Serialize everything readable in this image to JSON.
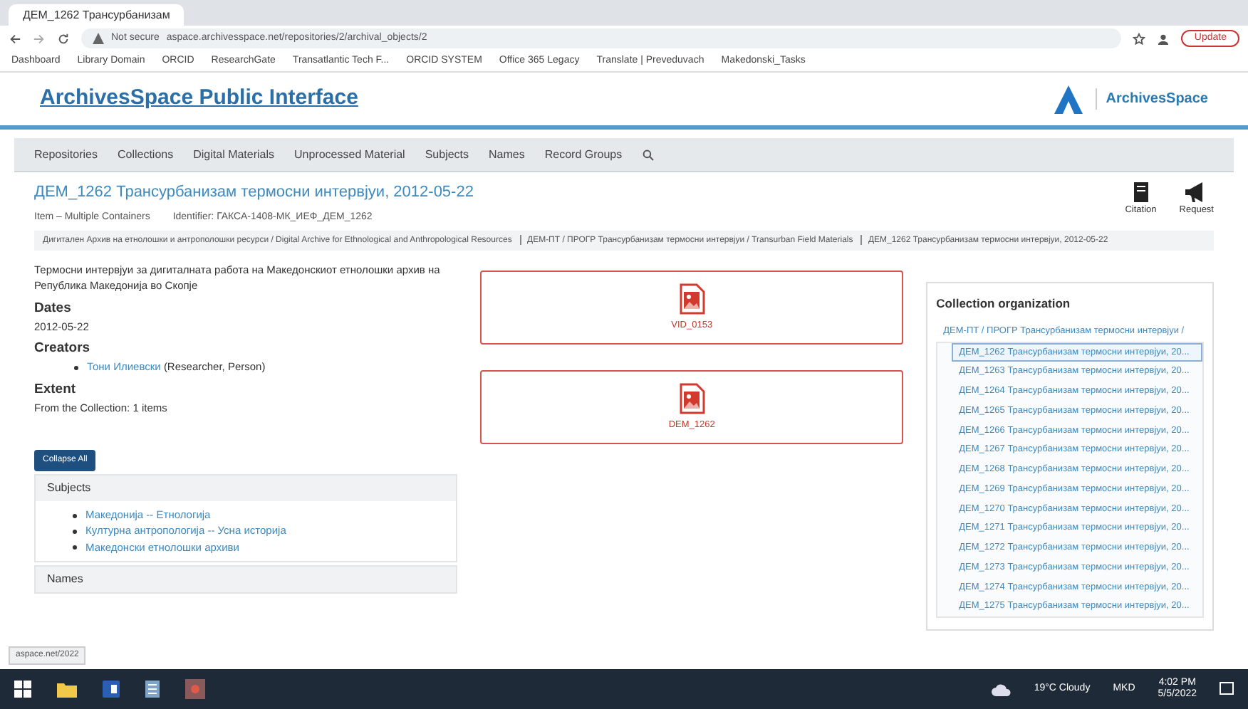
{
  "browser": {
    "tabs": [
      {
        "label": "ДЕМ_1262 Трансурбанизам",
        "selected": true
      }
    ],
    "address": {
      "security": "Not secure",
      "url": "aspace.archivesspace.net/repositories/2/archival_objects/2"
    },
    "update_button": "Update",
    "bookmarks": [
      "Dashboard",
      "Library Domain",
      "ORCID",
      "ResearchGate",
      "Transatlantic Tech F...",
      "ORCID SYSTEM",
      "Office 365 Legacy",
      "Translate | Preveduvach",
      "Makedonski_Tasks"
    ]
  },
  "site": {
    "title": "ArchivesSpace Public Interface",
    "logo_text": "ArchivesSpace"
  },
  "nav": [
    "Repositories",
    "Collections",
    "Digital Materials",
    "Unprocessed Material",
    "Subjects",
    "Names",
    "Record Groups"
  ],
  "record": {
    "title": "ДЕМ_1262 Трансурбанизам термосни интервјуи, 2012-05-22",
    "type": "Item – Multiple Containers",
    "identifier_label": "Identifier:",
    "identifier": "ГАКСА-1408-МК_ИЕФ_ДЕМ_1262",
    "actions": [
      "Citation",
      "Request"
    ],
    "breadcrumbs": [
      "Дигитален Архив на етнолошки и антрополошки ресурси / Digital Archive for Ethnological and Anthropological Resources",
      "ДЕМ-ПТ / ПРОГР Трансурбанизам термосни интервјуи / Transurban Field Materials",
      "ДЕМ_1262 Трансурбанизам термосни интервјуи, 2012-05-22"
    ],
    "summary": "Термосни интервјуи за дигиталната работа на Македонскиот етнолошки архив на Република Македонија во Скопје",
    "sections": [
      {
        "heading": "Dates",
        "items": [
          {
            "text": "2012-05-22"
          }
        ],
        "kind": "plain"
      },
      {
        "heading": "Creators",
        "items": [
          {
            "link": "Тони Илиевски",
            "text": "(Researcher, Person)"
          }
        ],
        "kind": "bullets"
      },
      {
        "heading": "Extent",
        "items": [
          {
            "text": "From the Collection: 1 items"
          }
        ],
        "kind": "plain"
      }
    ],
    "digital_objects": [
      "VID_0153",
      "DEM_1262"
    ],
    "collapse_button": "Collapse All",
    "subjects": {
      "heading": "Subjects",
      "items": [
        "Македонија -- Етнологија",
        "Културна антропологија -- Усна историја",
        "Македонски етнолошки архиви"
      ]
    },
    "names": {
      "heading": "Names"
    }
  },
  "tree": {
    "heading": "Collection organization",
    "root": {
      "label": "ДЕМ-ПТ / ПРОГР Трансурбанизам термосни интервјуи /",
      "children": [
        {
          "label": "ДЕМ_1262 Трансурбанизам термосни интервјуи, 20...",
          "selected": true
        },
        {
          "label": "ДЕМ_1263 Трансурбанизам термосни интервјуи, 20...",
          "selected": false
        },
        {
          "label": "ДЕМ_1264 Трансурбанизам термосни интервјуи, 20...",
          "selected": false
        },
        {
          "label": "ДЕМ_1265 Трансурбанизам термосни интервјуи, 20...",
          "selected": false
        },
        {
          "label": "ДЕМ_1266 Трансурбанизам термосни интервјуи, 20...",
          "selected": false
        },
        {
          "label": "ДЕМ_1267 Трансурбанизам термосни интервјуи, 20...",
          "selected": false
        },
        {
          "label": "ДЕМ_1268 Трансурбанизам термосни интервјуи, 20...",
          "selected": false
        },
        {
          "label": "ДЕМ_1269 Трансурбанизам термосни интервјуи, 20...",
          "selected": false
        },
        {
          "label": "ДЕМ_1270 Трансурбанизам термосни интервјуи, 20...",
          "selected": false
        },
        {
          "label": "ДЕМ_1271 Трансурбанизам термосни интервјуи, 20...",
          "selected": false
        },
        {
          "label": "ДЕМ_1272 Трансурбанизам термосни интервјуи, 20...",
          "selected": false
        },
        {
          "label": "ДЕМ_1273 Трансурбанизам термосни интервјуи, 20...",
          "selected": false
        },
        {
          "label": "ДЕМ_1274 Трансурбанизам термосни интервјуи, 20...",
          "selected": false
        },
        {
          "label": "ДЕМ_1275 Трансурбанизам термосни интервјуи, 20...",
          "selected": false
        }
      ]
    }
  },
  "status_link": "aspace.net/2022",
  "taskbar": {
    "weather": "19°C Cloudy",
    "lang": "MKD",
    "time": "4:02 PM",
    "date": "5/5/2022"
  }
}
